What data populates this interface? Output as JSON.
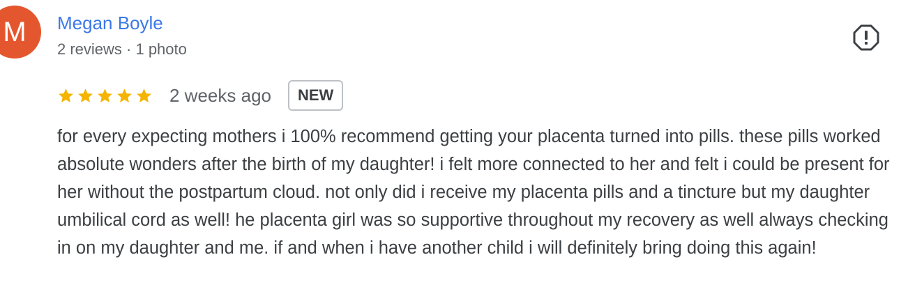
{
  "review": {
    "avatar_initial": "M",
    "author_name": "Megan Boyle",
    "author_meta": "2 reviews · 1 photo",
    "rating": 5,
    "rating_max": 5,
    "time": "2 weeks ago",
    "badge": "NEW",
    "text": "for every expecting mothers i 100% recommend getting your placenta turned into pills. these pills worked absolute wonders after the birth of my daughter! i felt more connected to her and felt i could be present for her without the postpartum cloud. not only did i receive my placenta pills and a tincture but my daughter umbilical cord as well! he placenta girl was so supportive throughout my recovery as well always checking in on my daughter and me. if and when i have another child i will definitely bring doing this again!"
  },
  "icons": {
    "report": "report-flag-icon",
    "star": "star-icon"
  },
  "colors": {
    "avatar": "#e4572e",
    "author_link": "#3b78e7",
    "star": "#f4b400",
    "text": "#3c4043",
    "muted": "#5f6368"
  }
}
